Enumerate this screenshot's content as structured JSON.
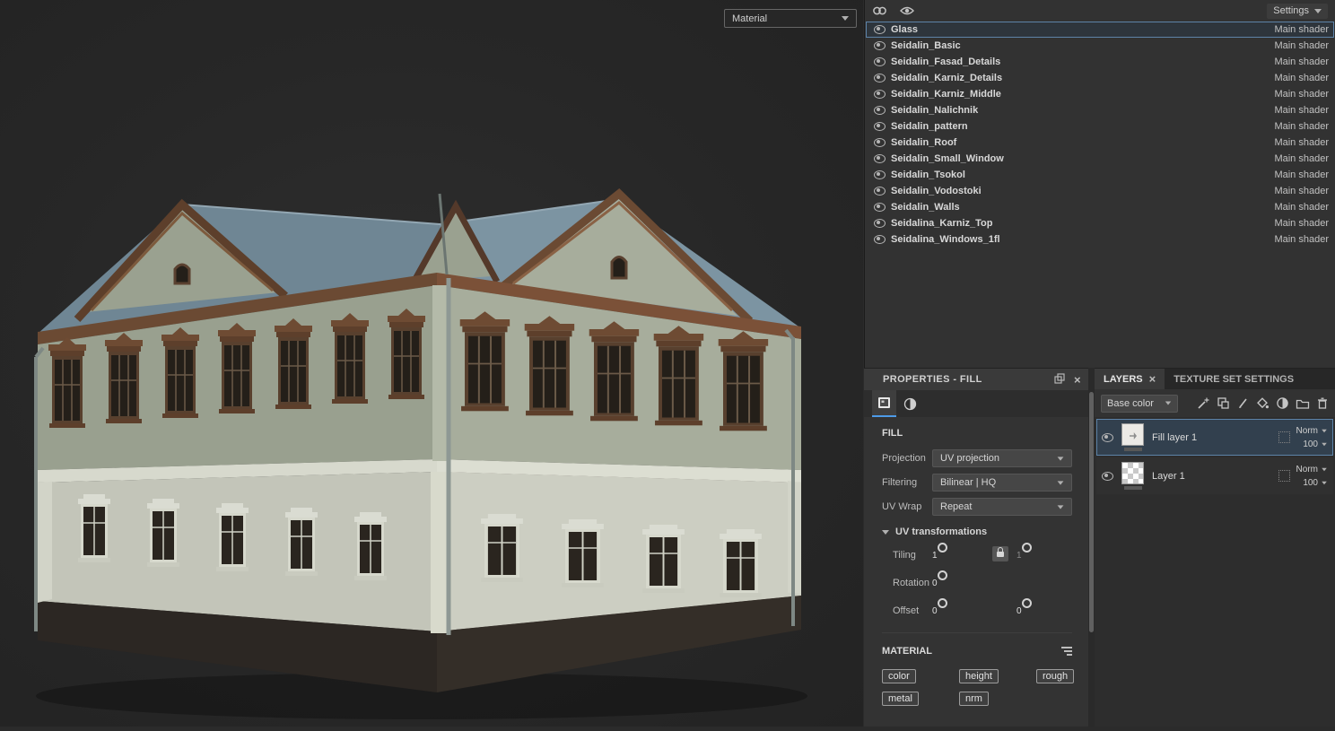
{
  "viewport": {
    "shading_mode_value": "Material"
  },
  "texture_set_list": {
    "settings_label": "Settings",
    "items": [
      {
        "name": "Glass",
        "shader": "Main shader",
        "selected": true
      },
      {
        "name": "Seidalin_Basic",
        "shader": "Main shader"
      },
      {
        "name": "Seidalin_Fasad_Details",
        "shader": "Main shader"
      },
      {
        "name": "Seidalin_Karniz_Details",
        "shader": "Main shader"
      },
      {
        "name": "Seidalin_Karniz_Middle",
        "shader": "Main shader"
      },
      {
        "name": "Seidalin_Nalichnik",
        "shader": "Main shader"
      },
      {
        "name": "Seidalin_pattern",
        "shader": "Main shader"
      },
      {
        "name": "Seidalin_Roof",
        "shader": "Main shader"
      },
      {
        "name": "Seidalin_Small_Window",
        "shader": "Main shader"
      },
      {
        "name": "Seidalin_Tsokol",
        "shader": "Main shader"
      },
      {
        "name": "Seidalin_Vodostoki",
        "shader": "Main shader"
      },
      {
        "name": "Seidalin_Walls",
        "shader": "Main shader"
      },
      {
        "name": "Seidalina_Karniz_Top",
        "shader": "Main shader"
      },
      {
        "name": "Seidalina_Windows_1fl",
        "shader": "Main shader"
      }
    ]
  },
  "properties_panel": {
    "title": "PROPERTIES - FILL",
    "close_glyph": "×",
    "fill_section": {
      "title": "FILL",
      "projection": {
        "label": "Projection",
        "value": "UV projection"
      },
      "filtering": {
        "label": "Filtering",
        "value": "Bilinear | HQ"
      },
      "uv_wrap": {
        "label": "UV Wrap",
        "value": "Repeat"
      },
      "uv_transformations": {
        "title": "UV transformations",
        "tiling": {
          "label": "Tiling",
          "x": "1",
          "y": "1"
        },
        "rotation": {
          "label": "Rotation",
          "value": "0"
        },
        "offset": {
          "label": "Offset",
          "x": "0",
          "y": "0"
        }
      }
    },
    "material_section": {
      "title": "MATERIAL",
      "channels": [
        "color",
        "height",
        "rough",
        "metal",
        "nrm"
      ]
    }
  },
  "layers_panel": {
    "tabs": [
      {
        "label": "LAYERS",
        "close_glyph": "×",
        "active": true
      },
      {
        "label": "TEXTURE SET SETTINGS"
      }
    ],
    "channel_filter_value": "Base color",
    "layers": [
      {
        "name": "Fill layer 1",
        "blend": "Norm",
        "opacity": "100",
        "selected": true
      },
      {
        "name": "Layer 1",
        "blend": "Norm",
        "opacity": "100"
      }
    ]
  }
}
